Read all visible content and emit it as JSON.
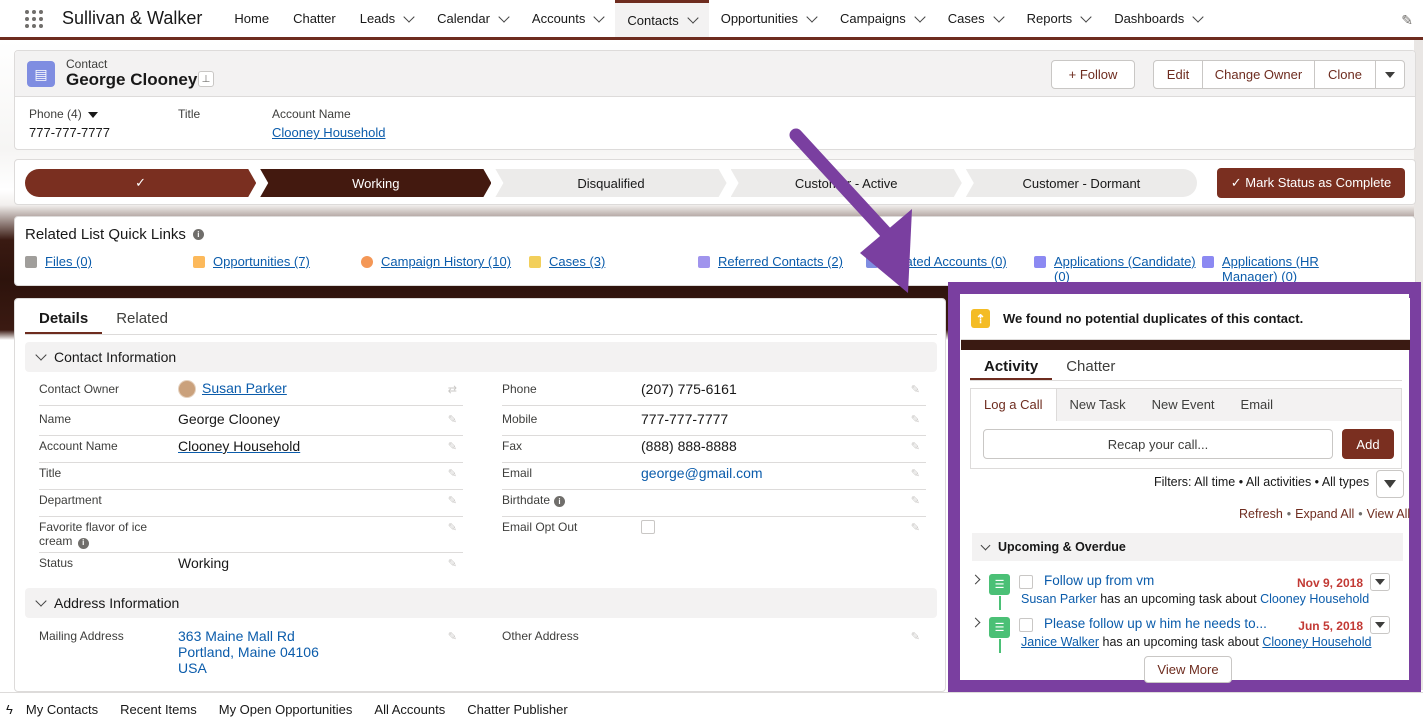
{
  "nav": {
    "app_name": "Sullivan & Walker",
    "items": [
      {
        "label": "Home",
        "dropdown": false
      },
      {
        "label": "Chatter",
        "dropdown": false
      },
      {
        "label": "Leads",
        "dropdown": true
      },
      {
        "label": "Calendar",
        "dropdown": true
      },
      {
        "label": "Accounts",
        "dropdown": true
      },
      {
        "label": "Contacts",
        "dropdown": true,
        "active": true
      },
      {
        "label": "Opportunities",
        "dropdown": true
      },
      {
        "label": "Campaigns",
        "dropdown": true
      },
      {
        "label": "Cases",
        "dropdown": true
      },
      {
        "label": "Reports",
        "dropdown": true
      },
      {
        "label": "Dashboards",
        "dropdown": true
      }
    ]
  },
  "header": {
    "object_label": "Contact",
    "record_name": "George Clooney",
    "buttons": {
      "follow": "+ Follow",
      "edit": "Edit",
      "change_owner": "Change Owner",
      "clone": "Clone"
    },
    "fields": {
      "phone_label": "Phone (4)",
      "phone_value": "777-777-7777",
      "title_label": "Title",
      "account_label": "Account Name",
      "account_value": "Clooney Household"
    }
  },
  "path": {
    "stages": [
      {
        "label": "✓",
        "state": "done"
      },
      {
        "label": "Working",
        "state": "current"
      },
      {
        "label": "Disqualified",
        "state": "todo"
      },
      {
        "label": "Customer - Active",
        "state": "todo"
      },
      {
        "label": "Customer - Dormant",
        "state": "todo"
      }
    ],
    "mark_button": "✓  Mark Status as Complete"
  },
  "quick_links": {
    "title": "Related List Quick Links",
    "items": [
      {
        "label": "Files (0)",
        "color": "#a09e9b"
      },
      {
        "label": "Opportunities (7)",
        "color": "#fcb95b"
      },
      {
        "label": "Campaign History (10)",
        "color": "#f49756"
      },
      {
        "label": "Cases (3)",
        "color": "#f2cf5b"
      },
      {
        "label": "Referred Contacts (2)",
        "color": "#a094ed"
      },
      {
        "label": "Related Accounts (0)",
        "color": "#7f8de1"
      },
      {
        "label": "Applications (Candidate) (0)",
        "color": "#8c89f2"
      },
      {
        "label": "Applications (HR Manager) (0)",
        "color": "#8c89f2"
      }
    ]
  },
  "details": {
    "tabs": [
      "Details",
      "Related"
    ],
    "section_contact": "Contact Information",
    "section_address": "Address Information",
    "left_fields": [
      {
        "label": "Contact Owner",
        "value": "Susan Parker",
        "link": true
      },
      {
        "label": "Name",
        "value": "George Clooney"
      },
      {
        "label": "Account Name",
        "value": "Clooney Household",
        "link": true
      },
      {
        "label": "Title",
        "value": ""
      },
      {
        "label": "Department",
        "value": ""
      },
      {
        "label": "Favorite flavor of ice cream",
        "value": ""
      },
      {
        "label": "Status",
        "value": "Working"
      }
    ],
    "right_fields": [
      {
        "label": "Phone",
        "value": "(207) 775-6161"
      },
      {
        "label": "Mobile",
        "value": "777-777-7777"
      },
      {
        "label": "Fax",
        "value": "(888) 888-8888"
      },
      {
        "label": "Email",
        "value": "george@gmail.com",
        "link": true
      },
      {
        "label": "Birthdate",
        "value": ""
      },
      {
        "label": "Email Opt Out",
        "value": ""
      }
    ],
    "mailing_label": "Mailing Address",
    "mailing_lines": [
      "363 Maine Mall Rd",
      "Portland, Maine 04106",
      "USA"
    ],
    "other_label": "Other Address"
  },
  "activity": {
    "duplicates_text": "We found no potential duplicates of this contact.",
    "tabs": [
      "Activity",
      "Chatter"
    ],
    "publisher_tabs": [
      "Log a Call",
      "New Task",
      "New Event",
      "Email"
    ],
    "recap_placeholder": "Recap your call...",
    "add_label": "Add",
    "filters_text": "Filters: All time • All activities • All types",
    "refresh": "Refresh",
    "expand_all": "Expand All",
    "view_all": "View All",
    "upcoming_title": "Upcoming & Overdue",
    "tasks": [
      {
        "title": "Follow up from vm",
        "date": "Nov 9, 2018",
        "who": "Susan Parker",
        "middle": "has an upcoming task about",
        "about": "Clooney Household"
      },
      {
        "title": "Please follow up w him he needs to...",
        "date": "Jun 5, 2018",
        "who": "Janice Walker",
        "middle": "has an upcoming task about",
        "about": "Clooney Household"
      }
    ],
    "view_more": "View More"
  },
  "utility_bar": [
    "My Contacts",
    "Recent Items",
    "My Open Opportunities",
    "All Accounts",
    "Chatter Publisher"
  ],
  "colors": {
    "brand": "#6e2c1f",
    "annotation": "#7a3fa0",
    "link": "#0b5cab"
  }
}
